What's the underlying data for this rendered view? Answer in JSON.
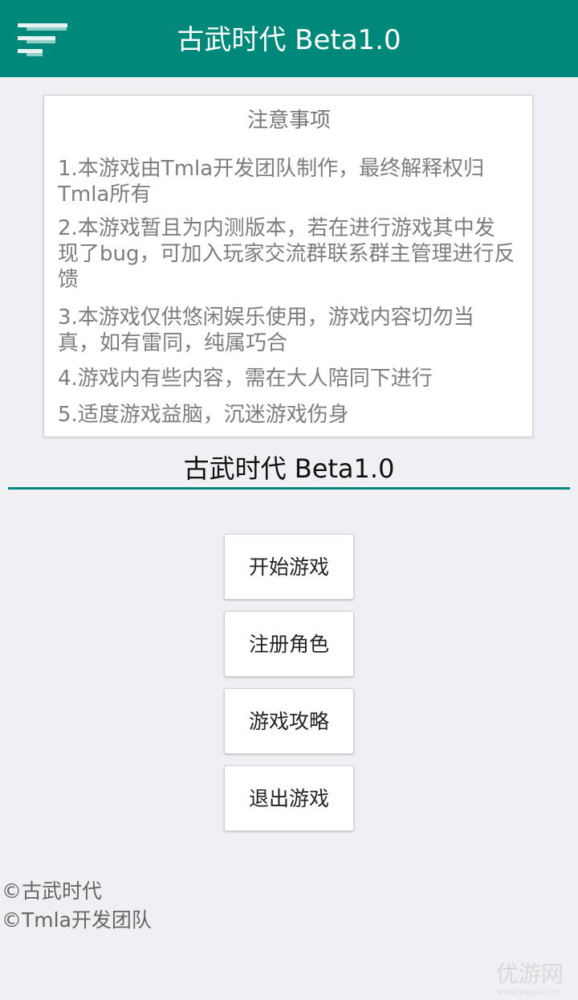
{
  "header": {
    "title": "古武时代 Beta1.0",
    "menu_icon": "hamburger-menu-icon"
  },
  "notice": {
    "title": "注意事项",
    "items": [
      "1.本游戏由Tmla开发团队制作，最终解释权归Tmla所有",
      "2.本游戏暂且为内测版本，若在进行游戏其中发现了bug，可加入玩家交流群联系群主管理进行反馈",
      "3.本游戏仅供悠闲娱乐使用，游戏内容切勿当真，如有雷同，纯属巧合",
      "4.游戏内有些内容，需在大人陪同下进行",
      "5.适度游戏益脑，沉迷游戏伤身"
    ]
  },
  "section": {
    "title": "古武时代 Beta1.0"
  },
  "buttons": {
    "start": "开始游戏",
    "register": "注册角色",
    "guide": "游戏攻略",
    "exit": "退出游戏"
  },
  "footer": {
    "line1": "©古武时代",
    "line2": "©Tmla开发团队"
  },
  "watermark": {
    "text": "优游网",
    "url_text": "www.yoyou.com"
  },
  "colors": {
    "primary": "#00897b",
    "background": "#efeff4"
  }
}
